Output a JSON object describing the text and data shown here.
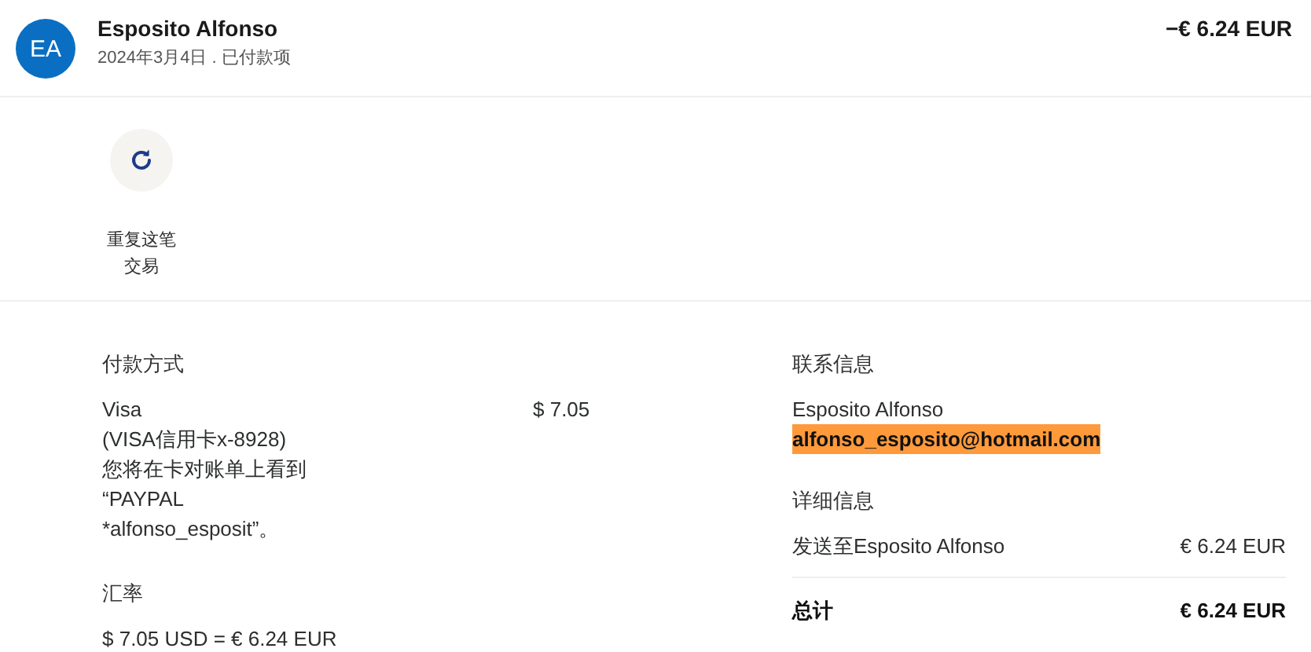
{
  "header": {
    "avatar": "EA",
    "name": "Esposito Alfonso",
    "subtitle": "2024年3月4日 . 已付款项",
    "amount": "−€ 6.24 EUR"
  },
  "actions": [
    {
      "label": "重复这笔交易",
      "kind": "repeat"
    }
  ],
  "payment": {
    "heading": "付款方式",
    "lines": [
      "Visa",
      "(VISA信用卡x-8928)",
      "您将在卡对账单上看到",
      "“PAYPAL",
      "*alfonso_esposit”。"
    ],
    "amount": "$ 7.05"
  },
  "exchange": {
    "heading": "汇率",
    "value": "$ 7.05 USD = € 6.24 EUR"
  },
  "contact": {
    "heading": "联系信息",
    "name": "Esposito Alfonso",
    "email": "alfonso_esposito@hotmail.com",
    "highlighted": true
  },
  "details": {
    "heading": "详细信息",
    "rows": [
      {
        "label": "发送至Esposito Alfonso",
        "value": "€ 6.24 EUR",
        "kind": "item"
      },
      {
        "label": "总计",
        "value": "€ 6.24 EUR",
        "kind": "total"
      }
    ]
  }
}
